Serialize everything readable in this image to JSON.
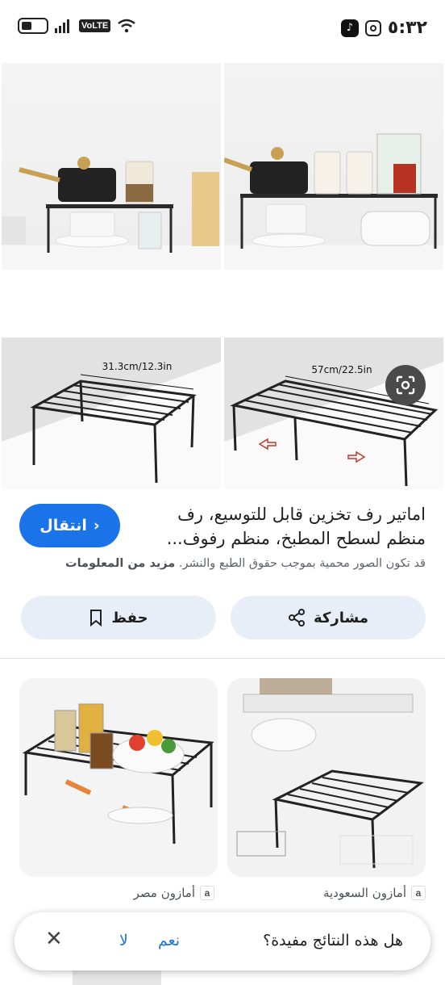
{
  "status_bar": {
    "time": "٥:٣٢",
    "volte": "VoLTE"
  },
  "images": {
    "dimension_small": "31.3cm/12.3in",
    "dimension_large": "57cm/22.5in"
  },
  "result": {
    "title": "اماتير رف تخزين قابل للتوسيع، رف منظم لسطح المطبخ، منظم رفوف...",
    "visit_label": "انتقال",
    "copyright": "قد تكون الصور محمية بموجب حقوق الطبع والنشر.",
    "more_info": "مزيد من المعلومات",
    "share_label": "مشاركة",
    "save_label": "حفظ"
  },
  "related": [
    {
      "source": "أمازون السعودية"
    },
    {
      "source": "أمازون مصر"
    }
  ],
  "feedback": {
    "question": "هل هذه النتائج مفيدة؟",
    "yes": "نعم",
    "no": "لا"
  },
  "colors": {
    "accent": "#1a73e8",
    "pill_bg": "#e8eef8"
  }
}
